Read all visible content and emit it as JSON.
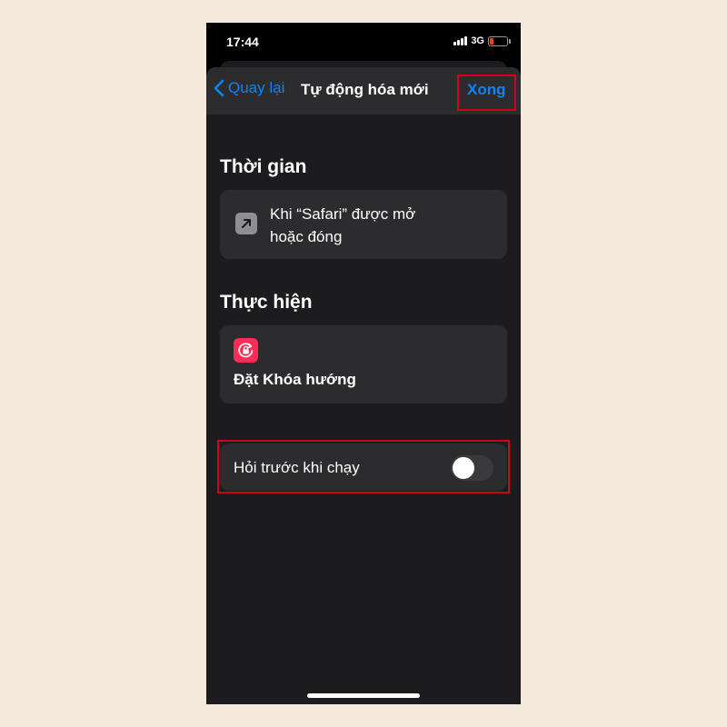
{
  "status_bar": {
    "time": "17:44",
    "network": "3G",
    "battery_level": 0.2,
    "battery_color": "#ff3b30"
  },
  "navbar": {
    "back_label": "Quay lại",
    "back_icon": "chevron-left-icon",
    "title": "Tự động hóa mới",
    "done_label": "Xong",
    "accent_color": "#0a84ff"
  },
  "trigger_section": {
    "header": "Thời gian",
    "icon": "arrow-up-right-icon",
    "text_line1": "Khi “Safari” được mở",
    "text_line2": "hoặc đóng"
  },
  "action_section": {
    "header": "Thực hiện",
    "icon": "rotation-lock-icon",
    "icon_color": "#ff2d55",
    "label": "Đặt Khóa hướng"
  },
  "ask_before_running": {
    "label": "Hỏi trước khi chạy",
    "enabled": false
  },
  "highlight_color": "#d0021b"
}
